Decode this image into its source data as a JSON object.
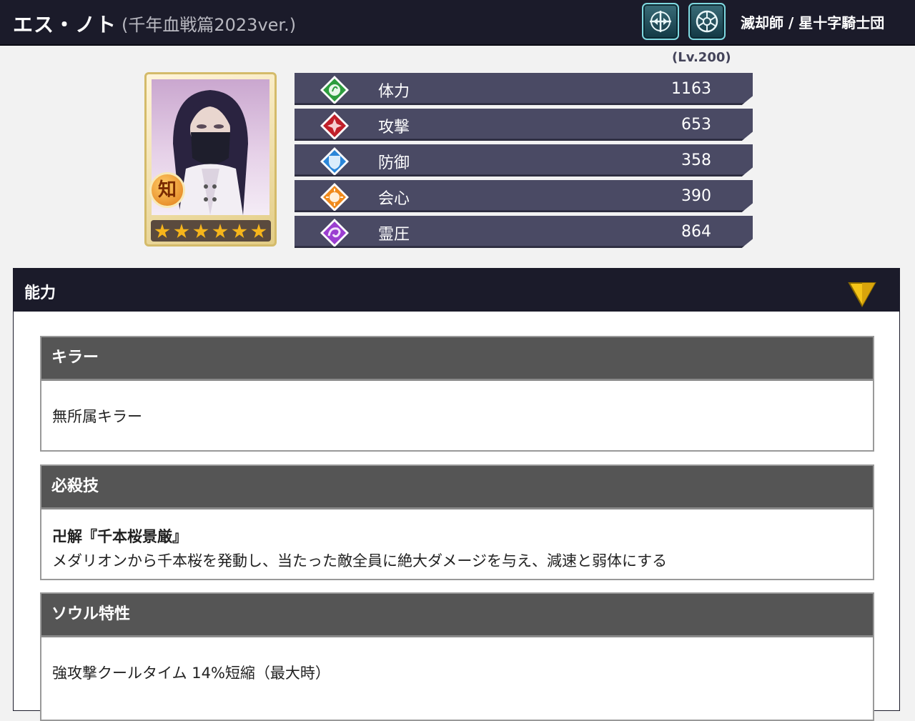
{
  "header": {
    "name": "エス・ノト",
    "subtitle": "(千年血戦篇2023ver.)",
    "icons": [
      "bow-attribute-icon",
      "quincy-emblem-icon"
    ],
    "affiliation": "滅却師 / 星十字騎士団"
  },
  "level": "(Lv.200)",
  "card": {
    "badge": "知",
    "rarity_stars": 6
  },
  "stats": [
    {
      "label": "体力",
      "value": "1163",
      "icon": "hp-icon",
      "color": "#2d9d3e"
    },
    {
      "label": "攻撃",
      "value": "653",
      "icon": "attack-icon",
      "color": "#c0202a"
    },
    {
      "label": "防御",
      "value": "358",
      "icon": "defense-icon",
      "color": "#2b86d8"
    },
    {
      "label": "会心",
      "value": "390",
      "icon": "critical-icon",
      "color": "#f08a1c"
    },
    {
      "label": "霊圧",
      "value": "864",
      "icon": "spirit-pressure-icon",
      "color": "#9b3ed0"
    }
  ],
  "ability": {
    "title": "能力",
    "toggle_icon": "triangle-down-icon",
    "sections": [
      {
        "title": "キラー",
        "text": "無所属キラー"
      },
      {
        "title": "必殺技",
        "skill_name": "卍解『千本桜景厳』",
        "text": "メダリオンから千本桜を発動し、当たった敵全員に絶大ダメージを与え、減速と弱体にする"
      },
      {
        "title": "ソウル特性",
        "text": "強攻撃クールタイム 14%短縮（最大時）"
      }
    ]
  },
  "colors": {
    "header_bg": "#1b1b2a",
    "stat_bar": "#4a4a64",
    "section_head": "#555555",
    "toggle_arrow": "#f5c518"
  }
}
